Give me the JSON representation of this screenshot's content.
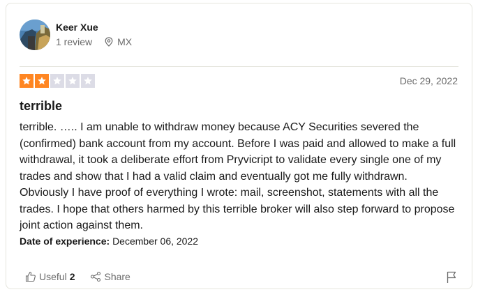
{
  "reviewer": {
    "name": "Keer Xue",
    "review_count": "1 review",
    "location": "MX"
  },
  "review": {
    "rating": 2,
    "max_rating": 5,
    "date": "Dec 29, 2022",
    "title": "terrible",
    "body": "terrible. ….. I am unable to withdraw money because ACY Securities severed the (confirmed) bank account from my account. Before I was paid and allowed to make a full withdrawal, it took a deliberate effort from Pryvicript to validate every single one of my trades and show that I had a valid claim and eventually got me fully withdrawn. Obviously I have proof of everything I wrote: mail, screenshot, statements with all the trades. I hope that others harmed by this terrible broker will also step forward to propose joint action against them.",
    "experience_label": "Date of experience:",
    "experience_date": "December 06, 2022"
  },
  "actions": {
    "useful_label": "Useful",
    "useful_count": "2",
    "share_label": "Share"
  },
  "colors": {
    "star_filled": "#ff8622",
    "star_empty": "#dcdce6",
    "text_primary": "#191919",
    "text_secondary": "#6a6a6a",
    "border": "#e5e5dd"
  },
  "icons": {
    "location": "map-pin-icon",
    "useful": "thumbs-up-icon",
    "share": "share-icon",
    "flag": "flag-icon",
    "star": "star-icon"
  }
}
